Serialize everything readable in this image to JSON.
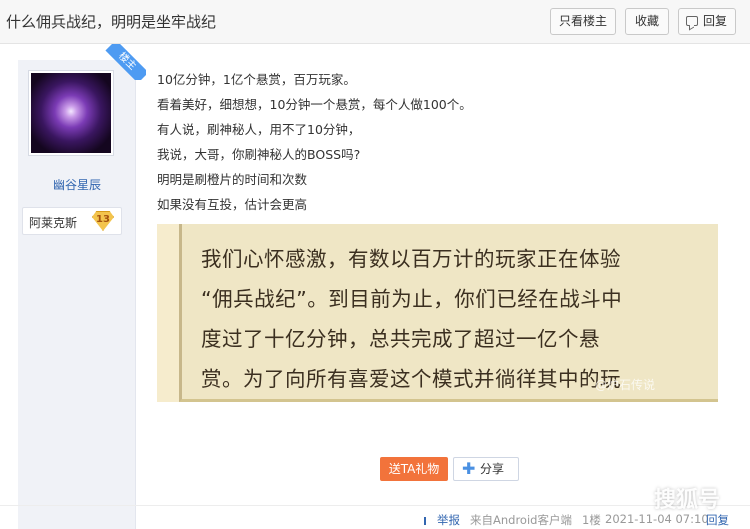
{
  "header": {
    "title": "什么佣兵战纪，明明是坐牢战纪",
    "only_op_label": "只看楼主",
    "favorite_label": "收藏",
    "reply_label": "回复"
  },
  "author": {
    "ribbon_label": "楼主",
    "username": "幽谷星辰",
    "level_name": "阿莱克斯",
    "level_number": "13"
  },
  "post": {
    "lines": [
      "10亿分钟，1亿个悬赏，百万玩家。",
      "看着美好，细想想，10分钟一个悬赏，每个人做100个。",
      "有人说，刷神秘人，用不了10分钟，",
      "我说，大哥，你刷神秘人的BOSS吗?",
      "明明是刷橙片的时间和次数",
      "如果没有互投，估计会更高"
    ],
    "image_text": [
      "我们心怀感激，有数以百万计的玩家正在体验",
      "“佣兵战纪”。到目前为止，你们已经在战斗中",
      "度过了十亿分钟，总共完成了超过一亿个悬",
      "赏。为了向所有喜爱这个模式并徜徉其中的玩"
    ],
    "image_watermark": "@炉石传说"
  },
  "actions": {
    "gift_label": "送TA礼物",
    "share_label": "分享"
  },
  "footer": {
    "report_label": "举报",
    "source": "来自Android客户端",
    "floor": "1楼",
    "time": "2021-11-04 07:10",
    "reply_label": "回复"
  },
  "watermark": "搜狐号",
  "colors": {
    "link_blue": "#3266b0",
    "gift_orange": "#f2733b",
    "ribbon_blue": "#4e9bf2"
  }
}
